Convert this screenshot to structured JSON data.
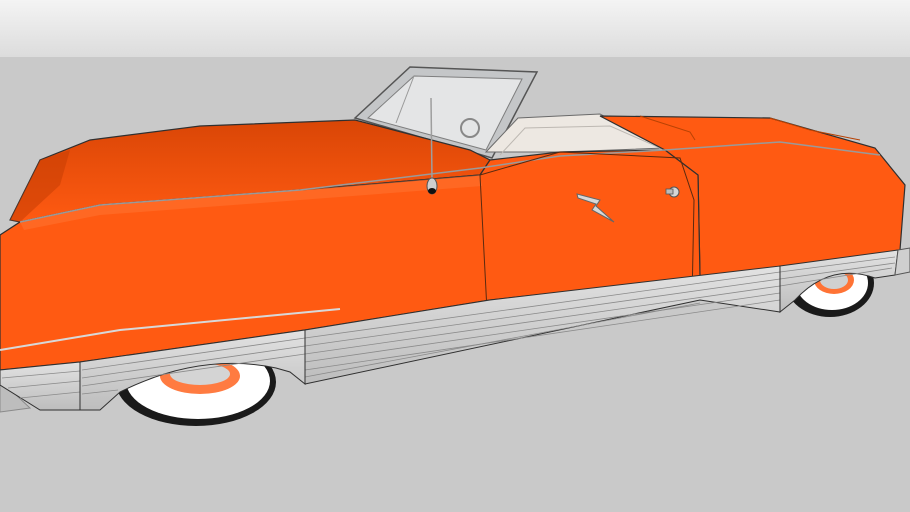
{
  "scene": {
    "subject": "car-model",
    "colors": {
      "sky_top": "#f2f2f2",
      "sky_bottom": "#d6d6d6",
      "ground": "#c8c8c8",
      "body": "#ff5a12",
      "body_shade": "#e24a08",
      "body_dark": "#c43c04",
      "trim": "#d2d2d2",
      "trim_line": "#8a8a8a",
      "outline": "#202020",
      "whitewall": "#ffffff",
      "tire": "#1a1a1a",
      "interior": "#ece7e1",
      "glass": "#bfc2c4"
    }
  }
}
